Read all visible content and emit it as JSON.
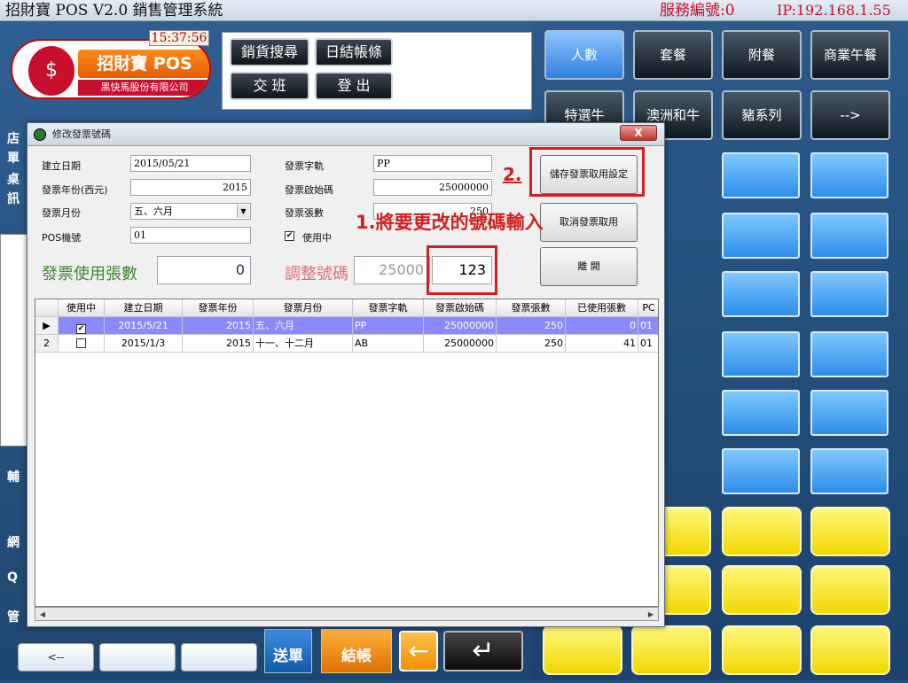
{
  "titlebar": {
    "title": "招財寶 POS V2.0 銷售管理系統",
    "service_no": "服務編號:0",
    "ip": "IP:192.168.1.55"
  },
  "header": {
    "clock": "15:37:56",
    "logo_name": "招財寶 POS",
    "logo_corp": "黑快馬股份有限公司",
    "logo_icon": "cat-logo-icon",
    "buttons": [
      "銷貨搜尋",
      "日結帳條",
      "交 班",
      "登 出"
    ]
  },
  "left": {
    "side_labels": [
      "店",
      "單",
      "桌",
      "訊"
    ],
    "bottom_side_labels": [
      "輔",
      "網",
      "Q",
      "管"
    ],
    "bottom_row": [
      "<--",
      "",
      ""
    ],
    "send_label": "送單",
    "pay_label": "結帳",
    "back_arrow": "←",
    "enter_arrow": "↵"
  },
  "categories": {
    "row1": [
      "人數",
      "套餐",
      "附餐",
      "商業午餐"
    ],
    "row2": [
      "特選牛",
      "澳洲和牛",
      "豬系列",
      "-->"
    ],
    "active": "人數"
  },
  "dialog": {
    "title": "修改發票號碼",
    "close": "X",
    "fields": {
      "create_date_label": "建立日期",
      "create_date": "2015/05/21",
      "year_label": "發票年份(西元)",
      "year": "2015",
      "month_label": "發票月份",
      "month": "五、六月",
      "pos_label": "POS機號",
      "pos": "01",
      "track_label": "發票字軌",
      "track": "PP",
      "start_label": "發票啟始碼",
      "start": "25000000",
      "count_label": "發票張數",
      "count": "250",
      "in_use_label": "使用中"
    },
    "used_count_label": "發票使用張數",
    "used_count": "0",
    "adjust_label": "調整號碼",
    "adjust_prefix": "25000",
    "adjust_value": "123",
    "buttons": {
      "save": "儲存發票取用設定",
      "cancel": "取消發票取用",
      "leave": "離 開"
    },
    "annotations": {
      "step1": "1.將要更改的號碼輸入",
      "step2": "2."
    },
    "grid": {
      "headers": [
        "使用中",
        "建立日期",
        "發票年份",
        "發票月份",
        "發票字軌",
        "發票啟始碼",
        "發票張數",
        "已使用張數",
        "PC"
      ],
      "rows": [
        {
          "indicator": "▶",
          "in_use": true,
          "date": "2015/5/21",
          "year": "2015",
          "month": "五、六月",
          "track": "PP",
          "start": "25000000",
          "count": "250",
          "used": "0",
          "pc": "01"
        },
        {
          "indicator": "2",
          "in_use": false,
          "date": "2015/1/3",
          "year": "2015",
          "month": "十一、十二月",
          "track": "AB",
          "start": "25000000",
          "count": "250",
          "used": "41",
          "pc": "01"
        }
      ]
    }
  }
}
